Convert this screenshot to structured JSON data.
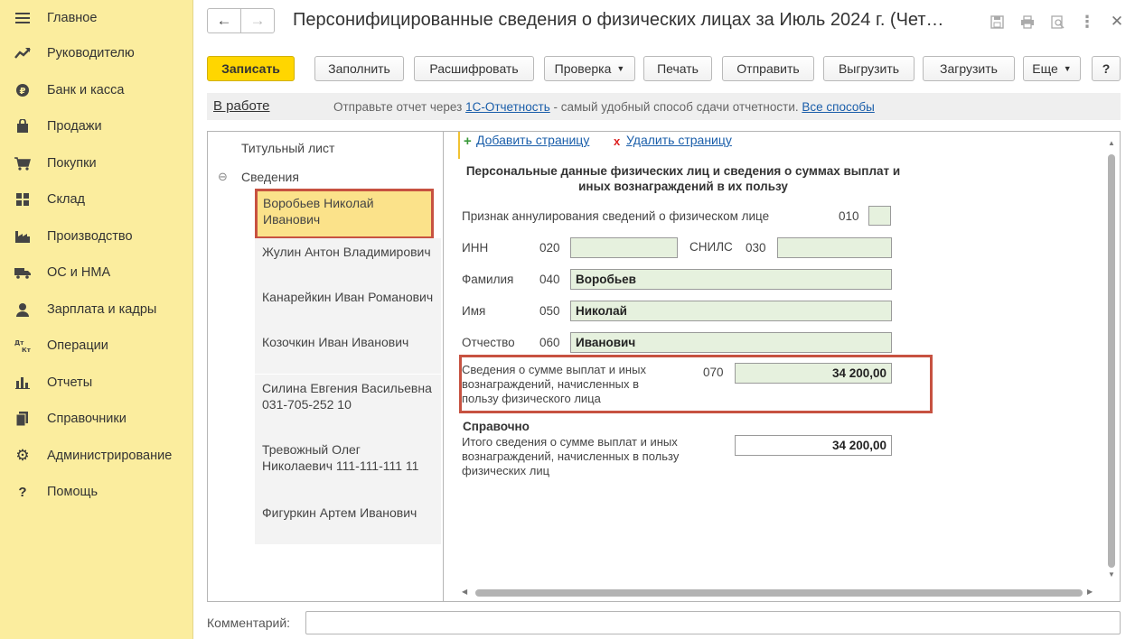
{
  "sidebar": {
    "items": [
      {
        "label": "Главное",
        "icon": "menu-icon"
      },
      {
        "label": "Руководителю",
        "icon": "trend-icon"
      },
      {
        "label": "Банк и касса",
        "icon": "coin-icon"
      },
      {
        "label": "Продажи",
        "icon": "bag-icon"
      },
      {
        "label": "Покупки",
        "icon": "cart-icon"
      },
      {
        "label": "Склад",
        "icon": "warehouse-icon"
      },
      {
        "label": "Производство",
        "icon": "factory-icon"
      },
      {
        "label": "ОС и НМА",
        "icon": "truck-icon"
      },
      {
        "label": "Зарплата и кадры",
        "icon": "person-icon"
      },
      {
        "label": "Операции",
        "icon": "dt-kt-icon"
      },
      {
        "label": "Отчеты",
        "icon": "bar-chart-icon"
      },
      {
        "label": "Справочники",
        "icon": "books-icon"
      },
      {
        "label": "Администрирование",
        "icon": "gear-icon"
      },
      {
        "label": "Помощь",
        "icon": "question-icon"
      }
    ]
  },
  "header": {
    "title": "Персонифицированные сведения о физических лицах за Июль 2024 г. (Чет…",
    "back": "←",
    "forward": "→"
  },
  "toolbar": {
    "save": "Записать",
    "fill": "Заполнить",
    "decode": "Расшифровать",
    "check": "Проверка",
    "print": "Печать",
    "send": "Отправить",
    "export": "Выгрузить",
    "import": "Загрузить",
    "more": "Еще",
    "help": "?"
  },
  "infobar": {
    "status": "В работе",
    "msg_prefix": "Отправьте отчет через ",
    "link1": "1С-Отчетность",
    "msg_middle": " - самый удобный способ сдачи отчетности. ",
    "link2": "Все способы"
  },
  "tree": {
    "title_page": "Титульный лист",
    "group": "Сведения",
    "toggle": "⊖",
    "persons": [
      "Воробьев Николай Иванович",
      "Жулин Антон Владимирович",
      "Канарейкин Иван Романович",
      "Козочкин Иван Иванович",
      "Силина Евгения Васильевна 031-705-252 10",
      "Тревожный Олег Николаевич 111-111-111 11",
      "Фигуркин Артем Иванович"
    ]
  },
  "form": {
    "add_page": "Добавить страницу",
    "delete_page": "Удалить страницу",
    "heading": "Персональные данные физических лиц и сведения о суммах выплат и иных вознаграждений в их пользу",
    "annul_label": "Признак аннулирования сведений о физическом лице",
    "annul_code": "010",
    "inn_label": "ИНН",
    "inn_code": "020",
    "inn_value": "",
    "snils_label": "СНИЛС",
    "snils_code": "030",
    "snils_value": "",
    "surname_label": "Фамилия",
    "surname_code": "040",
    "surname_value": "Воробьев",
    "name_label": "Имя",
    "name_code": "050",
    "name_value": "Николай",
    "patronymic_label": "Отчество",
    "patronymic_code": "060",
    "patronymic_value": "Иванович",
    "sum_label": "Сведения о сумме выплат и иных вознаграждений, начисленных в пользу физического лица",
    "sum_code": "070",
    "sum_value": "34 200,00",
    "ref_title": "Справочно",
    "total_label": "Итого сведения о сумме выплат и иных вознаграждений, начисленных в пользу физических лиц",
    "total_value": "34 200,00"
  },
  "comment": {
    "label": "Комментарий:",
    "value": ""
  }
}
